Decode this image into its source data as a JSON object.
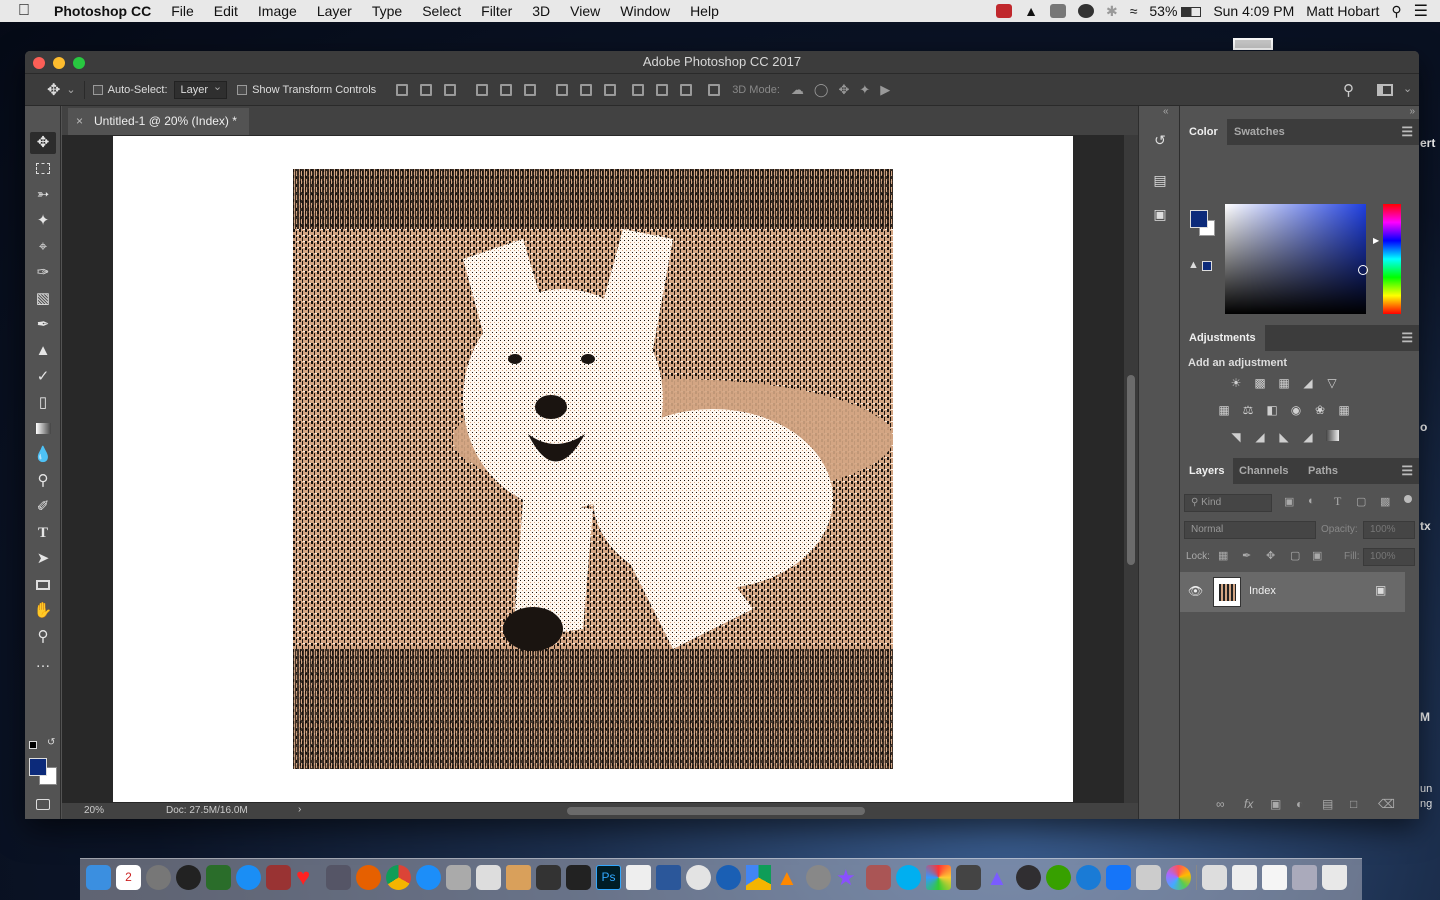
{
  "menubar": {
    "app": "Photoshop CC",
    "items": [
      "File",
      "Edit",
      "Image",
      "Layer",
      "Type",
      "Select",
      "Filter",
      "3D",
      "View",
      "Window",
      "Help"
    ],
    "battery": "53%",
    "clock": "Sun 4:09 PM",
    "user": "Matt Hobart"
  },
  "window": {
    "title": "Adobe Photoshop CC 2017"
  },
  "options": {
    "auto_select": "Auto-Select:",
    "auto_select_value": "Layer",
    "show_transform": "Show Transform Controls",
    "mode_3d": "3D Mode:"
  },
  "document": {
    "tab_title": "Untitled-1 @ 20% (Index) *",
    "zoom": "20%",
    "doc_info": "Doc: 27.5M/16.0M"
  },
  "color_panel": {
    "tabs": [
      "Color",
      "Swatches"
    ],
    "foreground": "#0c2a7a",
    "background": "#ffffff"
  },
  "adjustments_panel": {
    "tab": "Adjustments",
    "subtitle": "Add an adjustment"
  },
  "layers_panel": {
    "tabs": [
      "Layers",
      "Channels",
      "Paths"
    ],
    "kind": "Kind",
    "blend_mode": "Normal",
    "opacity_label": "Opacity:",
    "opacity_value": "100%",
    "lock_label": "Lock:",
    "fill_label": "Fill:",
    "fill_value": "100%",
    "layer_name": "Index"
  },
  "desktop": {
    "peek_a": "ert",
    "peek_b": "o",
    "peek_c": "tx",
    "peek_d": "M",
    "peek_e": "un",
    "peek_f": "ng",
    "dock_badge": "2"
  }
}
